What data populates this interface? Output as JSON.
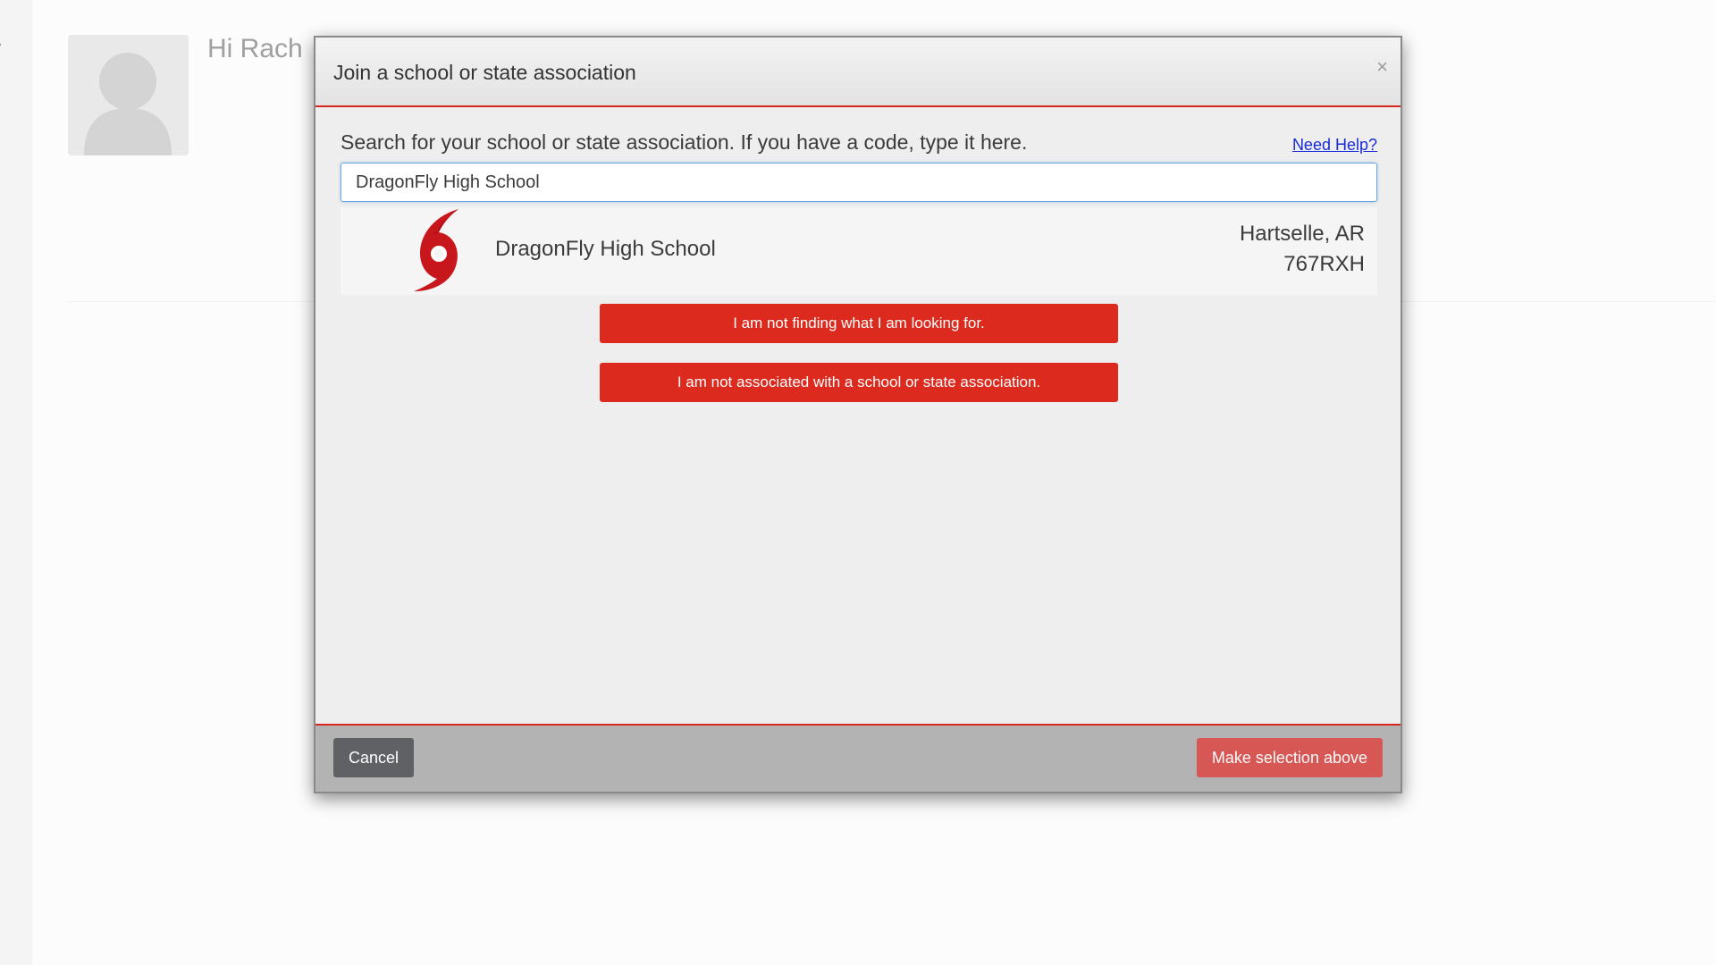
{
  "background": {
    "greeting": "Hi Rach"
  },
  "modal": {
    "title": "Join a school or state association",
    "close_label": "×",
    "instructions": "Search for your school or state association. If you have a code, type it here.",
    "help_link": "Need Help?",
    "search": {
      "value": "DragonFly High School",
      "placeholder": ""
    },
    "result": {
      "name": "DragonFly High School",
      "location": "Hartselle, AR",
      "code": "767RXH",
      "logo_icon": "hurricane-logo-icon",
      "logo_color": "#c8161d"
    },
    "buttons": {
      "not_finding": "I am not finding what I am looking for.",
      "not_associated": "I am not associated with a school or state association."
    },
    "footer": {
      "cancel_label": "Cancel",
      "select_label": "Make selection above"
    }
  },
  "colors": {
    "accent_red": "#dc2a1f",
    "link_blue": "#1a2bd6",
    "cancel_gray": "#5f6165"
  }
}
